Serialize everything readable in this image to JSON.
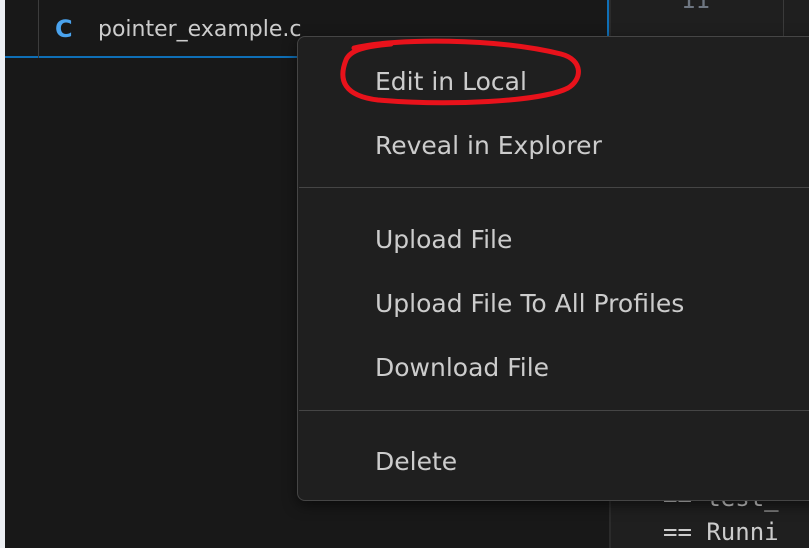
{
  "explorer": {
    "file": {
      "icon": "C",
      "icon_name": "c-language-file-icon",
      "name": "pointer_example.c"
    }
  },
  "editor": {
    "line_number": "11",
    "terminal_lines": [
      "== test_",
      "== Runni"
    ]
  },
  "context_menu": {
    "groups": [
      [
        "Edit in Local",
        "Reveal in Explorer"
      ],
      [
        "Upload File",
        "Upload File To All Profiles",
        "Download File"
      ],
      [
        "Delete"
      ]
    ]
  },
  "colors": {
    "accent": "#0f6fb6",
    "c_icon": "#4aa3ee",
    "annotation": "#e8121b",
    "menu_background": "#1f1f1f",
    "text": "#cccccc"
  }
}
